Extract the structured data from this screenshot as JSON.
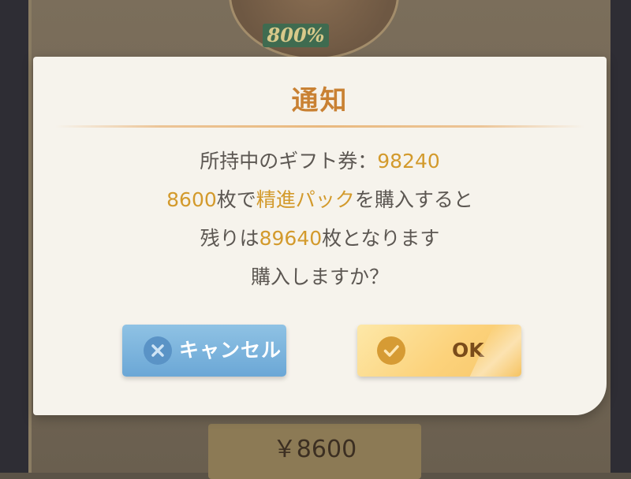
{
  "background": {
    "multiplier_badge": "800%",
    "price_button_label": "￥8600"
  },
  "dialog": {
    "title": "通知",
    "line1_prefix": "所持中のギフト券：",
    "gift_ticket_balance": "98240",
    "line2_cost": "8600",
    "line2_unit": "枚で",
    "pack_name": "精進パック",
    "line2_suffix": "を購入すると",
    "line3_prefix": "残りは",
    "remaining_balance": "89640",
    "line3_suffix": "枚となります",
    "line4": "購入しますか？",
    "cancel_label": "キャンセル",
    "ok_label": "OK"
  },
  "colors": {
    "title": "#c98133",
    "highlight": "#d39a2c",
    "body_text": "#5c5752",
    "cancel_button": "#6ba7d6",
    "ok_button": "#fcd27b"
  },
  "icons": {
    "cancel": "close-circle-icon",
    "ok": "checkmark-circle-icon"
  }
}
